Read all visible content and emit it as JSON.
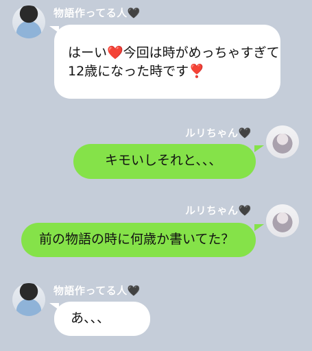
{
  "messages": [
    {
      "sender": "物語作ってる人🖤",
      "lines": [
        "はーい❤️今回は時がめっちゃすぎて",
        "12歳になった時です❣️"
      ]
    },
    {
      "sender": "ルリちゃん🖤",
      "lines": [
        "キモいしそれと、、、"
      ]
    },
    {
      "sender": "ルリちゃん🖤",
      "lines": [
        "前の物語の時に何歳か書いてた？"
      ]
    },
    {
      "sender": "物語作ってる人🖤",
      "lines": [
        "あ、、、"
      ]
    }
  ],
  "colors": {
    "background": "#c5cdd9",
    "incoming_bubble": "#ffffff",
    "outgoing_bubble": "#85e249"
  }
}
